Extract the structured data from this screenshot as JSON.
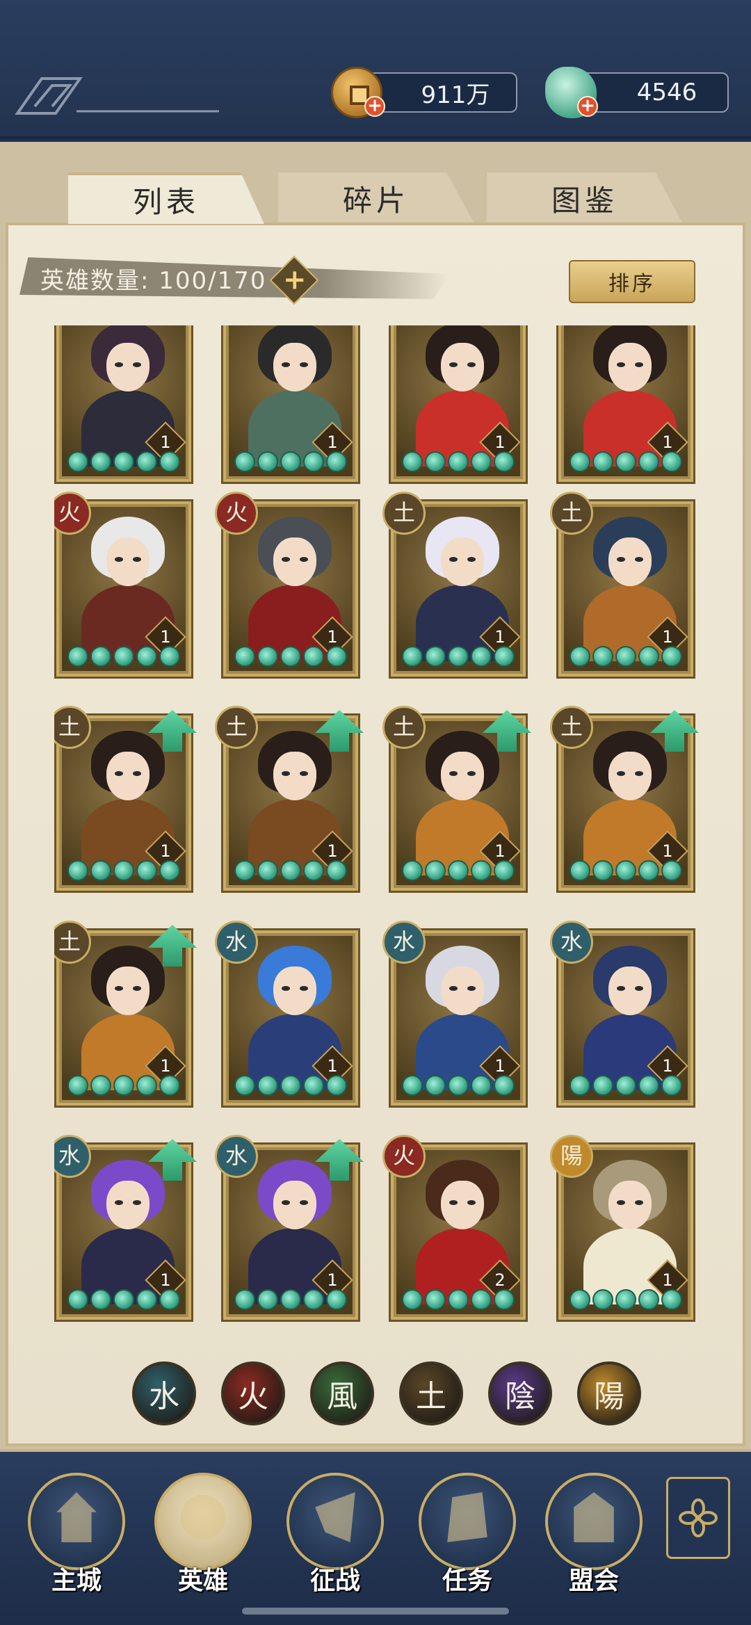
{
  "currency": {
    "coins": "911万",
    "jade": "4546"
  },
  "tabs": [
    "列表",
    "碎片",
    "图鉴"
  ],
  "hero_count": {
    "label": "英雄数量: 100/170"
  },
  "sort_button": "排序",
  "heroes": [
    {
      "element": "",
      "level": "1",
      "upgrade": false,
      "hair": "#3a2a3a",
      "body": "#2c2c3a"
    },
    {
      "element": "",
      "level": "1",
      "upgrade": false,
      "hair": "#2a2a2a",
      "body": "#4d7060"
    },
    {
      "element": "",
      "level": "1",
      "upgrade": false,
      "hair": "#2a1e1a",
      "body": "#c9302a"
    },
    {
      "element": "",
      "level": "1",
      "upgrade": false,
      "hair": "#2a1e1a",
      "body": "#c9302a"
    },
    {
      "element": "火",
      "level": "1",
      "upgrade": false,
      "hair": "#e8e8e8",
      "body": "#6a2a22"
    },
    {
      "element": "火",
      "level": "1",
      "upgrade": false,
      "hair": "#4a4e55",
      "body": "#8a1e1e"
    },
    {
      "element": "土",
      "level": "1",
      "upgrade": false,
      "hair": "#e8e6f2",
      "body": "#2a3050"
    },
    {
      "element": "土",
      "level": "1",
      "upgrade": false,
      "hair": "#2a3e5a",
      "body": "#b06a2a"
    },
    {
      "element": "土",
      "level": "1",
      "upgrade": true,
      "hair": "#2a1e1a",
      "body": "#7a4a20"
    },
    {
      "element": "土",
      "level": "1",
      "upgrade": true,
      "hair": "#2a1e1a",
      "body": "#7a4a20"
    },
    {
      "element": "土",
      "level": "1",
      "upgrade": true,
      "hair": "#2a1e1a",
      "body": "#c07a2a"
    },
    {
      "element": "土",
      "level": "1",
      "upgrade": true,
      "hair": "#2a1e1a",
      "body": "#c07a2a"
    },
    {
      "element": "土",
      "level": "1",
      "upgrade": true,
      "hair": "#2a1e1a",
      "body": "#c07a2a"
    },
    {
      "element": "水",
      "level": "1",
      "upgrade": false,
      "hair": "#3a7ad8",
      "body": "#2a3e7a"
    },
    {
      "element": "水",
      "level": "1",
      "upgrade": false,
      "hair": "#d8d8e2",
      "body": "#2a4a8a"
    },
    {
      "element": "水",
      "level": "1",
      "upgrade": false,
      "hair": "#2a3a6a",
      "body": "#2a3a7a"
    },
    {
      "element": "水",
      "level": "1",
      "upgrade": true,
      "hair": "#7a4ac8",
      "body": "#2a2a4a"
    },
    {
      "element": "水",
      "level": "1",
      "upgrade": true,
      "hair": "#7a4ac8",
      "body": "#2a2a4a"
    },
    {
      "element": "火",
      "level": "2",
      "upgrade": false,
      "hair": "#4a2a1a",
      "body": "#b02020"
    },
    {
      "element": "陽",
      "level": "1",
      "upgrade": false,
      "hair": "#a89a7a",
      "body": "#efe8d0"
    }
  ],
  "element_filters": [
    {
      "label": "水",
      "color": "#2f5f6a"
    },
    {
      "label": "火",
      "color": "#8a2a22"
    },
    {
      "label": "風",
      "color": "#3a6a3a"
    },
    {
      "label": "土",
      "color": "#5a4628"
    },
    {
      "label": "陰",
      "color": "#5a3a8a"
    },
    {
      "label": "陽",
      "color": "#c08a2a"
    }
  ],
  "element_colors": {
    "水": "#2f5f6a",
    "火": "#8a2a22",
    "土": "#5a4628",
    "陽": "#c08a2a"
  },
  "nav": [
    {
      "label": "主城",
      "icon": "castle-icon"
    },
    {
      "label": "英雄",
      "icon": "hero-icon"
    },
    {
      "label": "征战",
      "icon": "war-horn-icon"
    },
    {
      "label": "任务",
      "icon": "quest-scroll-icon"
    },
    {
      "label": "盟会",
      "icon": "guild-gate-icon"
    }
  ]
}
